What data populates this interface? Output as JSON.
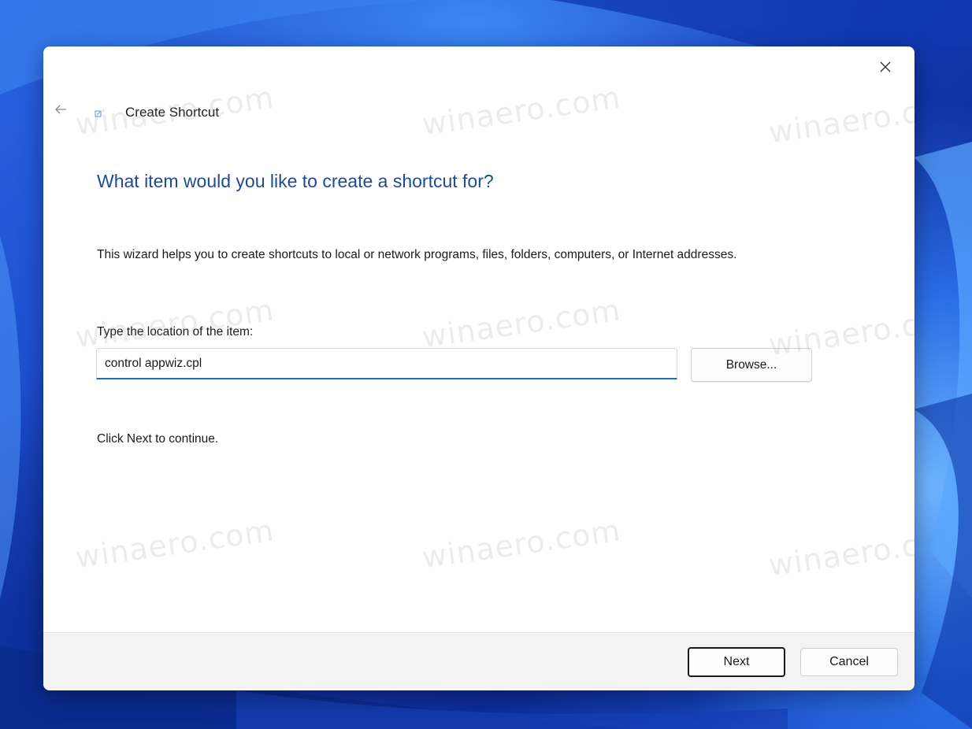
{
  "dialog": {
    "title": "Create Shortcut",
    "heading": "What item would you like to create a shortcut for?",
    "description": "This wizard helps you to create shortcuts to local or network programs, files, folders, computers, or Internet addresses.",
    "location_label": "Type the location of the item:",
    "location_value": "control appwiz.cpl",
    "browse_label": "Browse...",
    "continue_text": "Click Next to continue.",
    "next_label": "Next",
    "cancel_label": "Cancel"
  },
  "watermark": {
    "text": "winaero.com"
  },
  "icons": {
    "close": "close-icon",
    "back": "back-arrow-icon",
    "shortcut": "shortcut-icon"
  },
  "colors": {
    "heading": "#1f4b8f",
    "input_accent": "#1f6fb5",
    "footer_bg": "#f3f3f3"
  }
}
